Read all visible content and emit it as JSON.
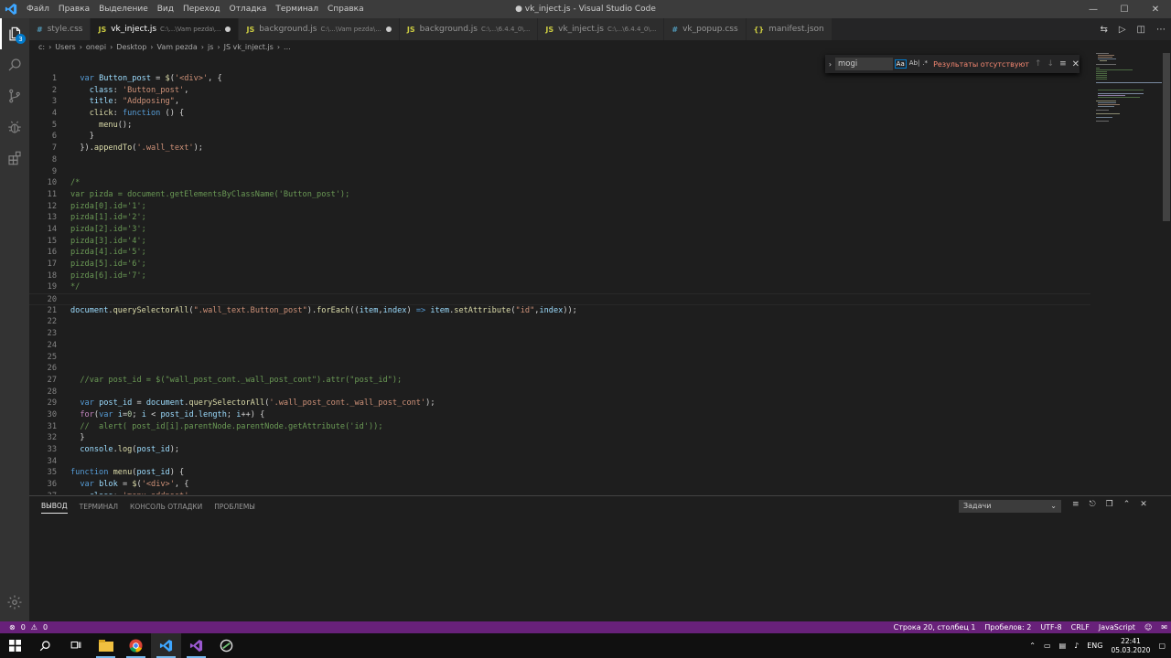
{
  "window": {
    "title": "● vk_inject.js - Visual Studio Code",
    "menu": [
      "Файл",
      "Правка",
      "Выделение",
      "Вид",
      "Переход",
      "Отладка",
      "Терминал",
      "Справка"
    ]
  },
  "activity": {
    "scm_badge": "3"
  },
  "tabs": [
    {
      "icon": "#",
      "kind": "css",
      "label": "style.css",
      "desc": "",
      "dirty": false,
      "active": false
    },
    {
      "icon": "JS",
      "kind": "js",
      "label": "vk_inject.js",
      "desc": "C:\\...\\Vam pezda\\...",
      "dirty": true,
      "active": true
    },
    {
      "icon": "JS",
      "kind": "js",
      "label": "background.js",
      "desc": "C:\\...\\Vam pezda\\...",
      "dirty": true,
      "active": false
    },
    {
      "icon": "JS",
      "kind": "js",
      "label": "background.js",
      "desc": "C:\\...\\6.4.4_0\\...",
      "dirty": false,
      "active": false
    },
    {
      "icon": "JS",
      "kind": "js",
      "label": "vk_inject.js",
      "desc": "C:\\...\\6.4.4_0\\...",
      "dirty": false,
      "active": false
    },
    {
      "icon": "#",
      "kind": "css",
      "label": "vk_popup.css",
      "desc": "",
      "dirty": false,
      "active": false
    },
    {
      "icon": "{}",
      "kind": "json",
      "label": "manifest.json",
      "desc": "",
      "dirty": false,
      "active": false
    }
  ],
  "breadcrumb": [
    "c:",
    "Users",
    "onepi",
    "Desktop",
    "Vam pezda",
    "js",
    "JS vk_inject.js",
    "..."
  ],
  "find": {
    "query": "mogi",
    "opt_case": "Aa",
    "opt_word": "Ab|",
    "opt_regex": ".*",
    "result": "Результаты отсутствуют"
  },
  "code": [
    {
      "n": "1",
      "t": [
        [
          "pl",
          "  "
        ],
        [
          "kw",
          "var"
        ],
        [
          "pl",
          " "
        ],
        [
          "var",
          "Button_post"
        ],
        [
          "pl",
          " = "
        ],
        [
          "fn",
          "$"
        ],
        [
          "pl",
          "("
        ],
        [
          "str",
          "'<div>'"
        ],
        [
          "pl",
          ", {"
        ]
      ]
    },
    {
      "n": "2",
      "t": [
        [
          "pl",
          "    "
        ],
        [
          "var",
          "class"
        ],
        [
          "pl",
          ": "
        ],
        [
          "str",
          "'Button_post'"
        ],
        [
          "pl",
          ","
        ]
      ]
    },
    {
      "n": "3",
      "t": [
        [
          "pl",
          "    "
        ],
        [
          "var",
          "title"
        ],
        [
          "pl",
          ": "
        ],
        [
          "str",
          "\"Addposing\""
        ],
        [
          "pl",
          ","
        ]
      ]
    },
    {
      "n": "4",
      "t": [
        [
          "pl",
          "    "
        ],
        [
          "fn",
          "click"
        ],
        [
          "pl",
          ": "
        ],
        [
          "kw",
          "function"
        ],
        [
          "pl",
          " () {"
        ]
      ]
    },
    {
      "n": "5",
      "t": [
        [
          "pl",
          "      "
        ],
        [
          "fn",
          "menu"
        ],
        [
          "pl",
          "();"
        ]
      ]
    },
    {
      "n": "6",
      "t": [
        [
          "pl",
          "    }"
        ]
      ]
    },
    {
      "n": "7",
      "t": [
        [
          "pl",
          "  })."
        ],
        [
          "fn",
          "appendTo"
        ],
        [
          "pl",
          "("
        ],
        [
          "str",
          "'.wall_text'"
        ],
        [
          "pl",
          ");"
        ]
      ]
    },
    {
      "n": "8",
      "t": []
    },
    {
      "n": "9",
      "t": []
    },
    {
      "n": "10",
      "t": [
        [
          "cm",
          "/*"
        ]
      ]
    },
    {
      "n": "11",
      "t": [
        [
          "cm",
          "var pizda = document.getElementsByClassName('Button_post');"
        ]
      ]
    },
    {
      "n": "12",
      "t": [
        [
          "cm",
          "pizda[0].id='1';"
        ]
      ]
    },
    {
      "n": "13",
      "t": [
        [
          "cm",
          "pizda[1].id='2';"
        ]
      ]
    },
    {
      "n": "14",
      "t": [
        [
          "cm",
          "pizda[2].id='3';"
        ]
      ]
    },
    {
      "n": "15",
      "t": [
        [
          "cm",
          "pizda[3].id='4';"
        ]
      ]
    },
    {
      "n": "16",
      "t": [
        [
          "cm",
          "pizda[4].id='5';"
        ]
      ]
    },
    {
      "n": "17",
      "t": [
        [
          "cm",
          "pizda[5].id='6';"
        ]
      ]
    },
    {
      "n": "18",
      "t": [
        [
          "cm",
          "pizda[6].id='7';"
        ]
      ]
    },
    {
      "n": "19",
      "t": [
        [
          "cm",
          "*/"
        ]
      ]
    },
    {
      "n": "20",
      "t": [],
      "current": true
    },
    {
      "n": "21",
      "t": [
        [
          "var",
          "document"
        ],
        [
          "pl",
          "."
        ],
        [
          "fn",
          "querySelectorAll"
        ],
        [
          "pl",
          "("
        ],
        [
          "str",
          "\".wall_text.Button_post\""
        ],
        [
          "pl",
          ")."
        ],
        [
          "fn",
          "forEach"
        ],
        [
          "pl",
          "(("
        ],
        [
          "var",
          "item"
        ],
        [
          "pl",
          ","
        ],
        [
          "var",
          "index"
        ],
        [
          "pl",
          ") "
        ],
        [
          "kw",
          "=>"
        ],
        [
          "pl",
          " "
        ],
        [
          "var",
          "item"
        ],
        [
          "pl",
          "."
        ],
        [
          "fn",
          "setAttribute"
        ],
        [
          "pl",
          "("
        ],
        [
          "str",
          "\"id\""
        ],
        [
          "pl",
          ","
        ],
        [
          "var",
          "index"
        ],
        [
          "pl",
          "));"
        ]
      ]
    },
    {
      "n": "22",
      "t": []
    },
    {
      "n": "23",
      "t": []
    },
    {
      "n": "24",
      "t": []
    },
    {
      "n": "25",
      "t": []
    },
    {
      "n": "26",
      "t": []
    },
    {
      "n": "27",
      "t": [
        [
          "pl",
          "  "
        ],
        [
          "cm",
          "//var post_id = $(\"wall_post_cont._wall_post_cont\").attr(\"post_id\");"
        ]
      ]
    },
    {
      "n": "28",
      "t": []
    },
    {
      "n": "29",
      "t": [
        [
          "pl",
          "  "
        ],
        [
          "kw",
          "var"
        ],
        [
          "pl",
          " "
        ],
        [
          "var",
          "post_id"
        ],
        [
          "pl",
          " = "
        ],
        [
          "var",
          "document"
        ],
        [
          "pl",
          "."
        ],
        [
          "fn",
          "querySelectorAll"
        ],
        [
          "pl",
          "("
        ],
        [
          "str",
          "'.wall_post_cont._wall_post_cont'"
        ],
        [
          "pl",
          ");"
        ]
      ]
    },
    {
      "n": "30",
      "t": [
        [
          "pl",
          "  "
        ],
        [
          "ctrl",
          "for"
        ],
        [
          "pl",
          "("
        ],
        [
          "kw",
          "var"
        ],
        [
          "pl",
          " "
        ],
        [
          "var",
          "i"
        ],
        [
          "pl",
          "="
        ],
        [
          "num",
          "0"
        ],
        [
          "pl",
          "; "
        ],
        [
          "var",
          "i"
        ],
        [
          "pl",
          " < "
        ],
        [
          "var",
          "post_id"
        ],
        [
          "pl",
          "."
        ],
        [
          "var",
          "length"
        ],
        [
          "pl",
          "; "
        ],
        [
          "var",
          "i"
        ],
        [
          "pl",
          "++) {"
        ]
      ]
    },
    {
      "n": "31",
      "t": [
        [
          "pl",
          "  "
        ],
        [
          "cm",
          "//  alert( post_id[i].parentNode.parentNode.getAttribute('id'));"
        ]
      ]
    },
    {
      "n": "32",
      "t": [
        [
          "pl",
          "  }"
        ]
      ]
    },
    {
      "n": "33",
      "t": [
        [
          "pl",
          "  "
        ],
        [
          "var",
          "console"
        ],
        [
          "pl",
          "."
        ],
        [
          "fn",
          "log"
        ],
        [
          "pl",
          "("
        ],
        [
          "var",
          "post_id"
        ],
        [
          "pl",
          ");"
        ]
      ]
    },
    {
      "n": "34",
      "t": []
    },
    {
      "n": "35",
      "t": [
        [
          "kw",
          "function"
        ],
        [
          "pl",
          " "
        ],
        [
          "fn",
          "menu"
        ],
        [
          "pl",
          "("
        ],
        [
          "var",
          "post_id"
        ],
        [
          "pl",
          ") {"
        ]
      ]
    },
    {
      "n": "36",
      "t": [
        [
          "pl",
          "  "
        ],
        [
          "kw",
          "var"
        ],
        [
          "pl",
          " "
        ],
        [
          "var",
          "blok"
        ],
        [
          "pl",
          " = "
        ],
        [
          "fn",
          "$"
        ],
        [
          "pl",
          "("
        ],
        [
          "str",
          "'<div>'"
        ],
        [
          "pl",
          ", {"
        ]
      ]
    },
    {
      "n": "37",
      "t": [
        [
          "pl",
          "    "
        ],
        [
          "var",
          "class"
        ],
        [
          "pl",
          ": "
        ],
        [
          "str",
          "'menu_addpost'"
        ]
      ]
    }
  ],
  "panel": {
    "tabs": [
      "ВЫВОД",
      "ТЕРМИНАЛ",
      "КОНСОЛЬ ОТЛАДКИ",
      "ПРОБЛЕМЫ"
    ],
    "select": "Задачи"
  },
  "status": {
    "errors": "0",
    "warnings": "0",
    "position": "Строка 20, столбец 1",
    "spaces": "Пробелов: 2",
    "encoding": "UTF-8",
    "eol": "CRLF",
    "language": "JavaScript"
  },
  "taskbar": {
    "lang": "ENG",
    "time": "22:41",
    "date": "05.03.2020"
  },
  "colors": {
    "statusbar": "#68217a",
    "activitybar": "#333333",
    "editor_bg": "#1e1e1e"
  }
}
